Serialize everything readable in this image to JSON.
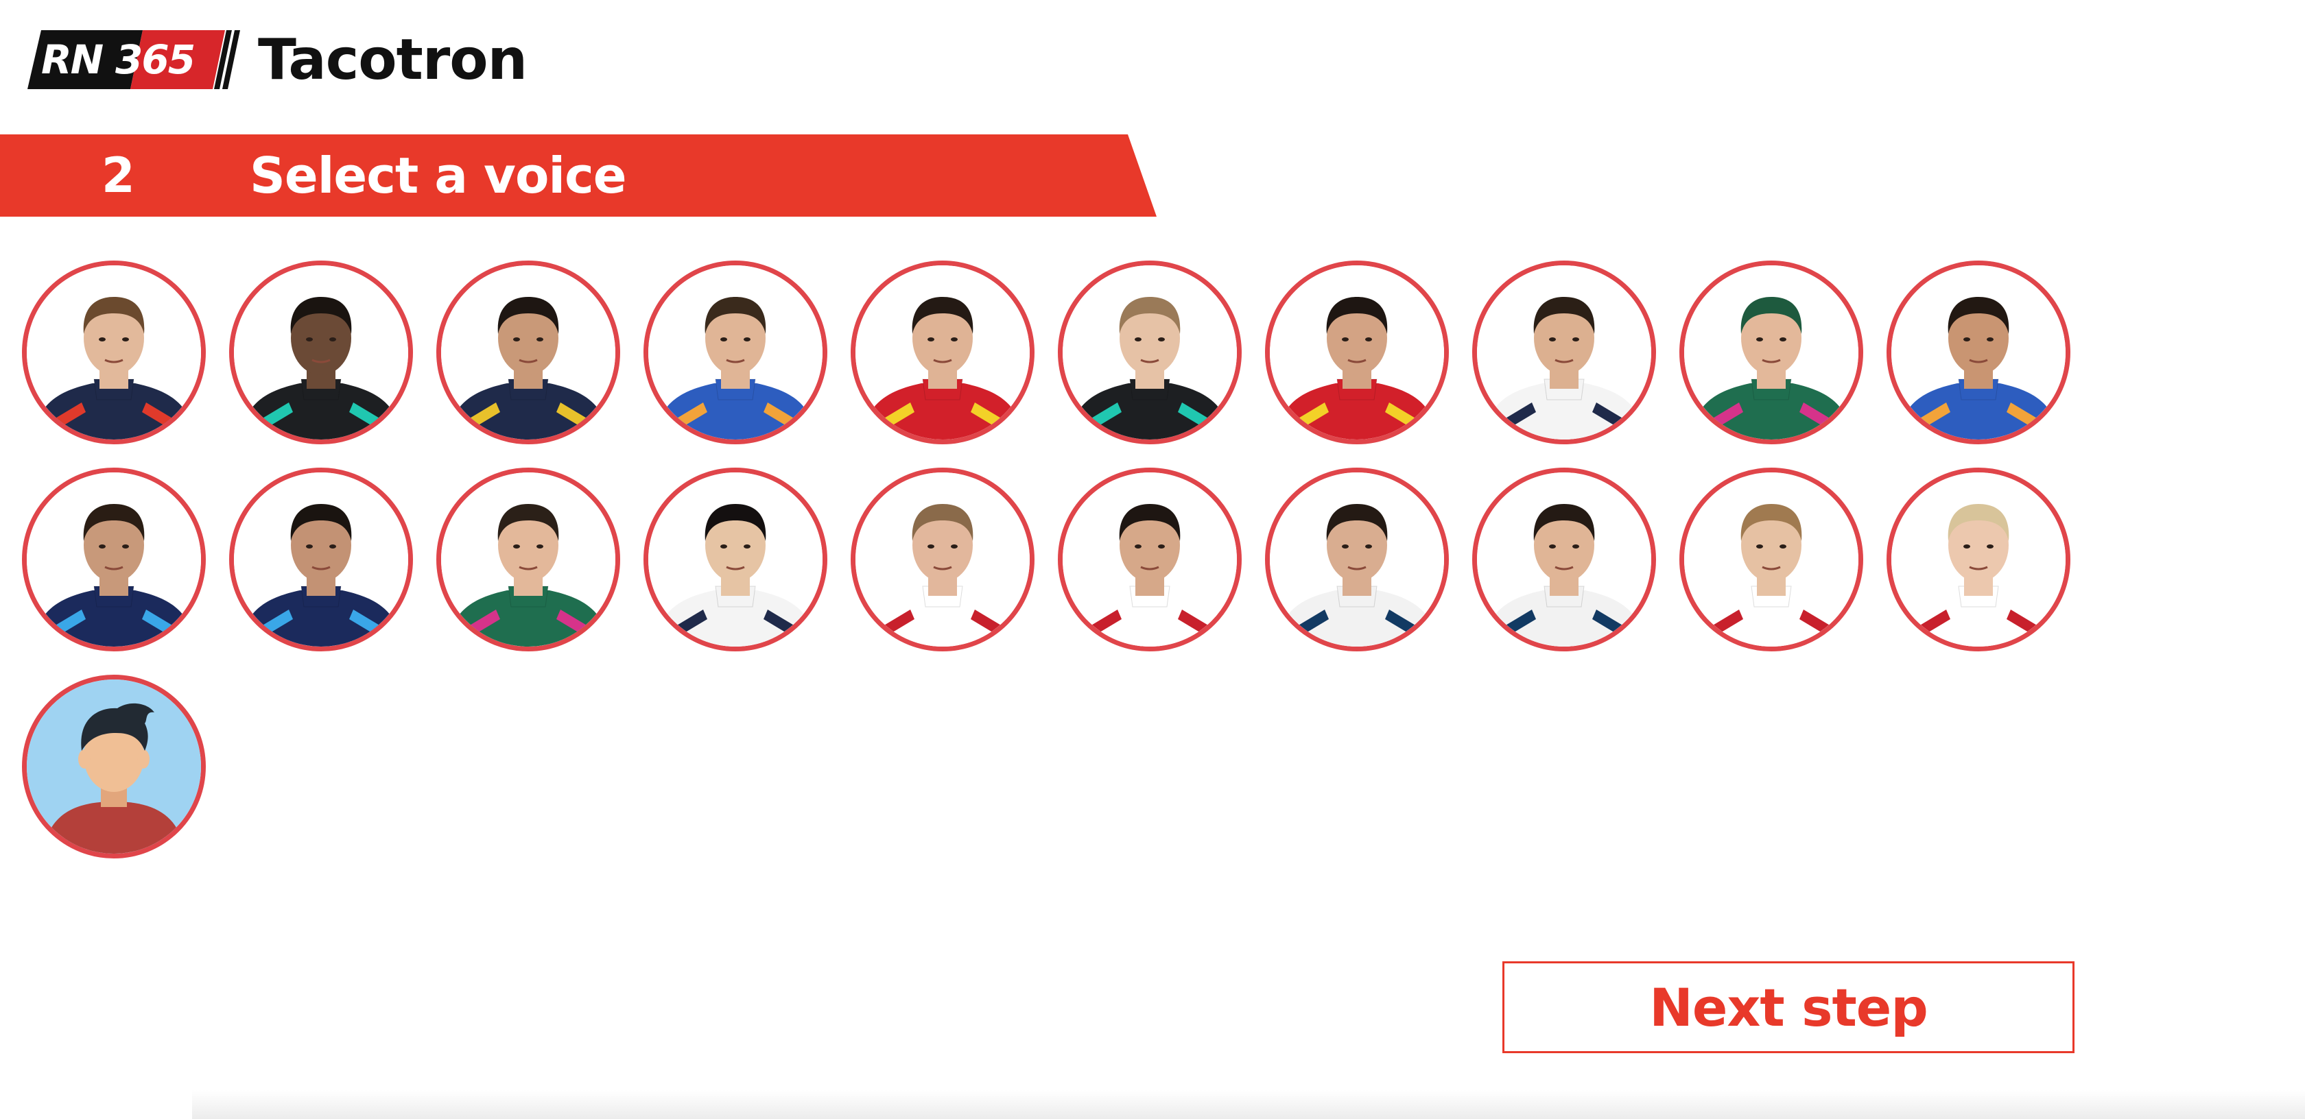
{
  "header": {
    "logo_rn": "RN",
    "logo_365": "365",
    "app_title": "Tacotron"
  },
  "step": {
    "number": "2",
    "title": "Select a voice"
  },
  "voices": [
    {
      "id": "voice-1",
      "suit": "#1f2a4a",
      "accent": "#e03a2b",
      "skin": "#e2b99b",
      "hair": "#6b4a2e"
    },
    {
      "id": "voice-2",
      "suit": "#1d1f22",
      "accent": "#20c7b0",
      "skin": "#6b4a36",
      "hair": "#1a1410"
    },
    {
      "id": "voice-3",
      "suit": "#1f2a4a",
      "accent": "#e8c12b",
      "skin": "#c99978",
      "hair": "#1e1612"
    },
    {
      "id": "voice-4",
      "suit": "#2d5dbf",
      "accent": "#f2a33a",
      "skin": "#e0b596",
      "hair": "#3a2a1c"
    },
    {
      "id": "voice-5",
      "suit": "#d2202a",
      "accent": "#f3d128",
      "skin": "#dfb395",
      "hair": "#241a14"
    },
    {
      "id": "voice-6",
      "suit": "#1d1f22",
      "accent": "#20c7b0",
      "skin": "#e6c2a6",
      "hair": "#9a7a58"
    },
    {
      "id": "voice-7",
      "suit": "#d2202a",
      "accent": "#f3d128",
      "skin": "#d3a384",
      "hair": "#1e1612"
    },
    {
      "id": "voice-8",
      "suit": "#f4f4f4",
      "accent": "#1f2a4a",
      "skin": "#dcb090",
      "hair": "#2b1f16"
    },
    {
      "id": "voice-9",
      "suit": "#1f6e4f",
      "accent": "#d6338a",
      "skin": "#e3b89a",
      "hair": "#1e5a3e"
    },
    {
      "id": "voice-10",
      "suit": "#2d5dbf",
      "accent": "#f2a33a",
      "skin": "#c99572",
      "hair": "#221812"
    },
    {
      "id": "voice-11",
      "suit": "#1b2a5c",
      "accent": "#3aa7e8",
      "skin": "#c8997a",
      "hair": "#2a1d14"
    },
    {
      "id": "voice-12",
      "suit": "#1b2a5c",
      "accent": "#3aa7e8",
      "skin": "#c39274",
      "hair": "#1a1410"
    },
    {
      "id": "voice-13",
      "suit": "#1f6e4f",
      "accent": "#d6338a",
      "skin": "#e3b89a",
      "hair": "#2b2018"
    },
    {
      "id": "voice-14",
      "suit": "#f4f4f4",
      "accent": "#1f2a4a",
      "skin": "#e6c4a4",
      "hair": "#141010"
    },
    {
      "id": "voice-15",
      "suit": "#ffffff",
      "accent": "#c8202c",
      "skin": "#e2b79c",
      "hair": "#8a6a4a"
    },
    {
      "id": "voice-16",
      "suit": "#ffffff",
      "accent": "#c8202c",
      "skin": "#d6a889",
      "hair": "#1e1612"
    },
    {
      "id": "voice-17",
      "suit": "#f2f2f2",
      "accent": "#123a63",
      "skin": "#d9ad90",
      "hair": "#241a14"
    },
    {
      "id": "voice-18",
      "suit": "#f2f2f2",
      "accent": "#123a63",
      "skin": "#e0b596",
      "hair": "#241a14"
    },
    {
      "id": "voice-19",
      "suit": "#ffffff",
      "accent": "#c8202c",
      "skin": "#e6c1a3",
      "hair": "#a07a50"
    },
    {
      "id": "voice-20",
      "suit": "#ffffff",
      "accent": "#c8202c",
      "skin": "#ecc8ae",
      "hair": "#d8c49a"
    },
    {
      "id": "voice-custom",
      "avatar": true,
      "bg": "#9fd3f2",
      "shirt": "#b4403a",
      "skin": "#f0bf95",
      "hair": "#222a33"
    }
  ],
  "next_button": {
    "label": "Next step"
  },
  "colors": {
    "brand_red": "#e8392a",
    "circle_border": "#e0454a"
  }
}
